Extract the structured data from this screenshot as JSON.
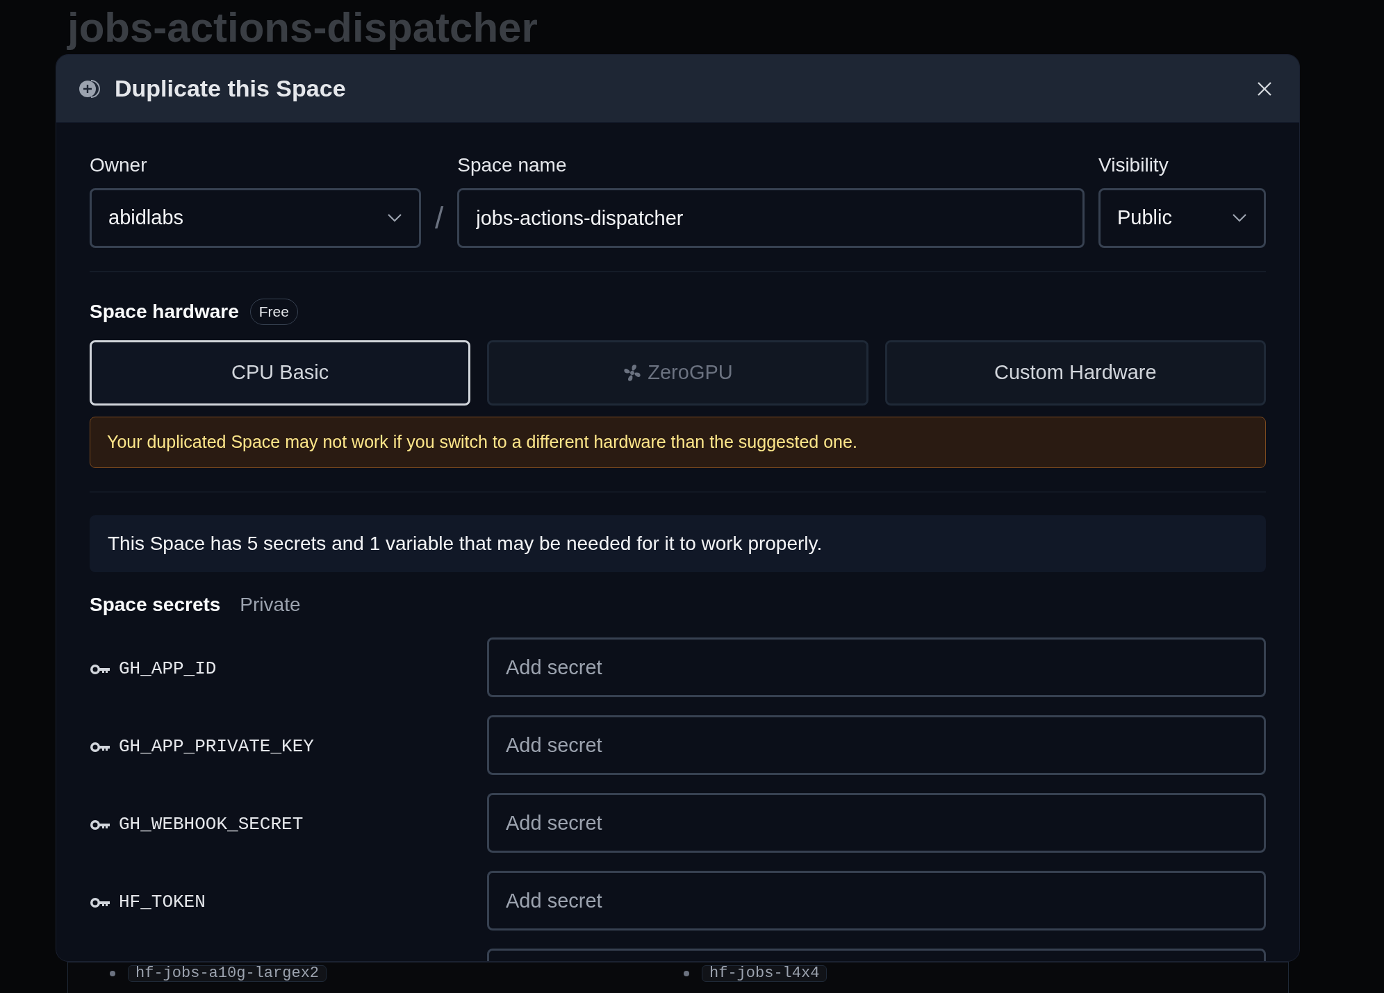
{
  "page": {
    "title": "jobs-actions-dispatcher",
    "list_items": [
      "hf-jobs-a10g-largex2",
      "hf-jobs-l4x4"
    ]
  },
  "dialog": {
    "title": "Duplicate this Space",
    "owner": {
      "label": "Owner",
      "value": "abidlabs"
    },
    "separator": "/",
    "space_name": {
      "label": "Space name",
      "value": "jobs-actions-dispatcher"
    },
    "visibility": {
      "label": "Visibility",
      "value": "Public"
    },
    "hardware": {
      "label": "Space hardware",
      "badge": "Free",
      "options": [
        {
          "label": "CPU Basic",
          "selected": true,
          "disabled": false,
          "icon": false
        },
        {
          "label": "ZeroGPU",
          "selected": false,
          "disabled": true,
          "icon": true
        },
        {
          "label": "Custom Hardware",
          "selected": false,
          "disabled": false,
          "icon": false
        }
      ]
    },
    "warning": "Your duplicated Space may not work if you switch to a different hardware than the suggested one.",
    "info": "This Space has 5 secrets and 1 variable that may be needed for it to work properly.",
    "secrets": {
      "label": "Space secrets",
      "tag": "Private",
      "items": [
        {
          "name": "GH_APP_ID",
          "placeholder": "Add secret"
        },
        {
          "name": "GH_APP_PRIVATE_KEY",
          "placeholder": "Add secret"
        },
        {
          "name": "GH_WEBHOOK_SECRET",
          "placeholder": "Add secret"
        },
        {
          "name": "HF_TOKEN",
          "placeholder": "Add secret"
        }
      ]
    }
  }
}
